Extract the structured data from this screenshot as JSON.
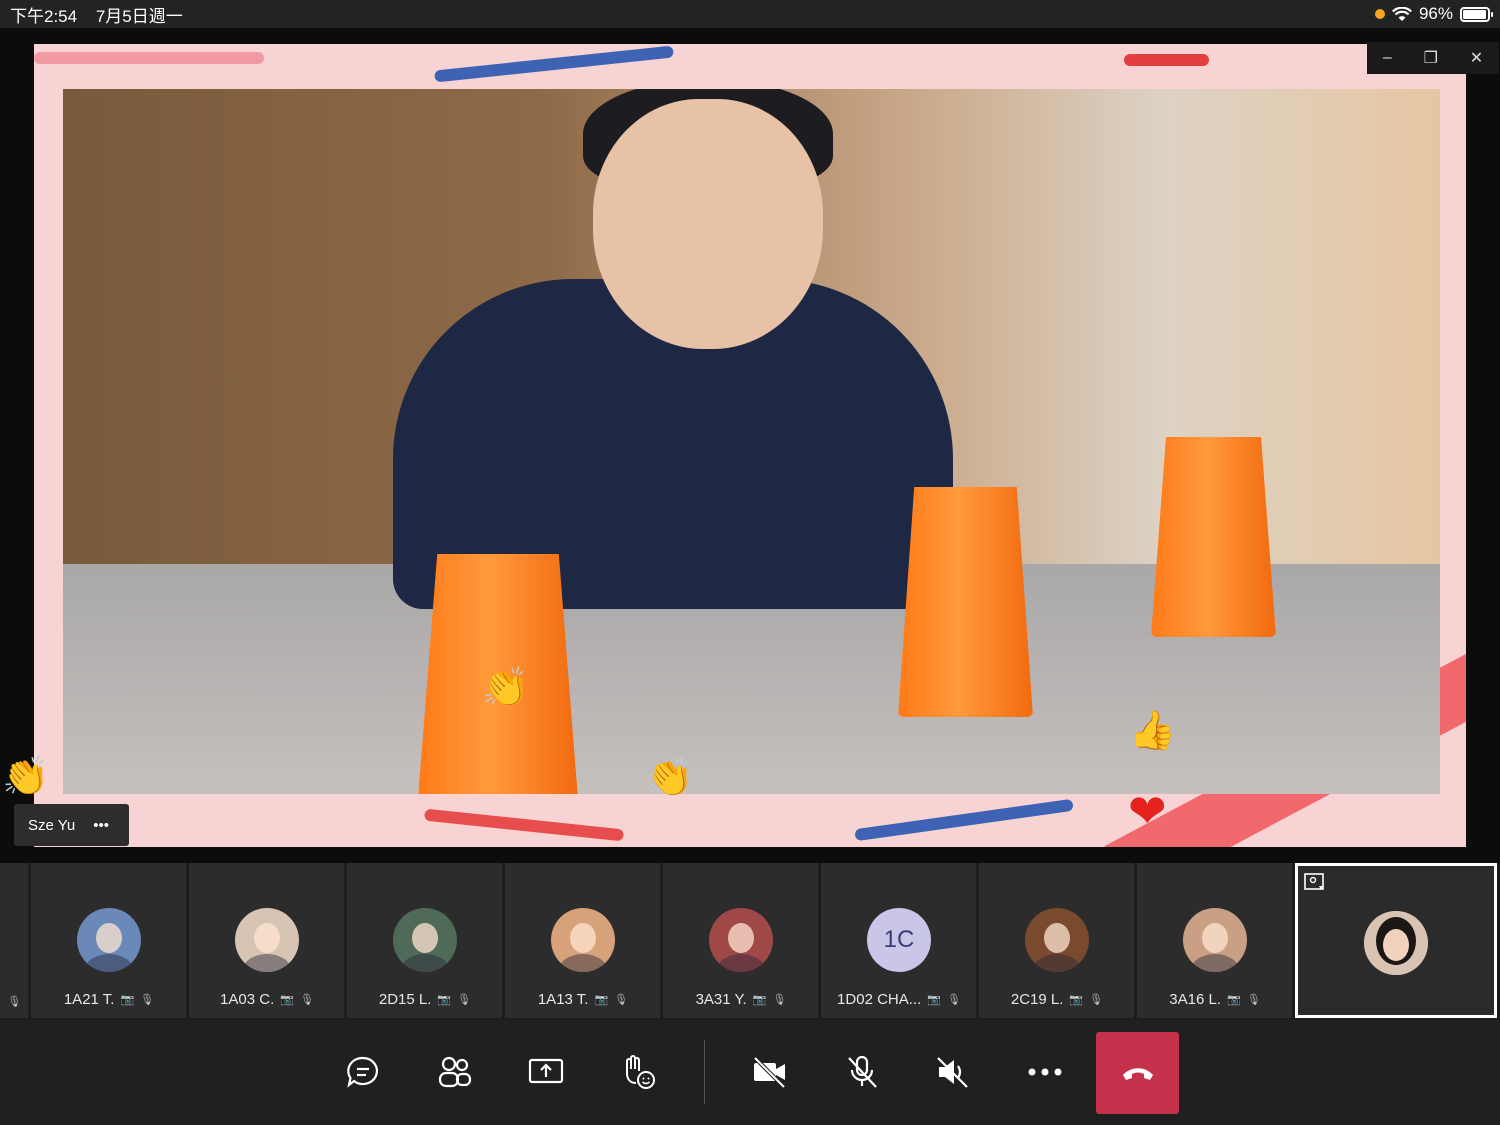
{
  "status_bar": {
    "time": "下午2:54",
    "date": "7月5日週一",
    "battery": "96%",
    "battery_level": 0.96,
    "icons": [
      "orange-dot-icon",
      "wifi-icon",
      "battery-icon"
    ]
  },
  "main_video": {
    "participant_name": "Sze Yu",
    "more_label": "•••"
  },
  "window_controls": {
    "minimize": "–",
    "restore": "❐",
    "close": "✕"
  },
  "participants": [
    {
      "name": "1A21 T.",
      "avatar": "photo",
      "color": "#6a88b8"
    },
    {
      "name": "1A03 C.",
      "avatar": "photo",
      "color": "#d8c4b2"
    },
    {
      "name": "2D15 L.",
      "avatar": "photo",
      "color": "#4f6a58"
    },
    {
      "name": "1A13 T.",
      "avatar": "photo",
      "color": "#d7a179"
    },
    {
      "name": "3A31 Y.",
      "avatar": "photo",
      "color": "#a04848"
    },
    {
      "name": "1D02 CHA...",
      "avatar": "initials",
      "initials": "1C",
      "color": "#c9c6e8"
    },
    {
      "name": "2C19 L.",
      "avatar": "photo",
      "color": "#7a4a2f"
    },
    {
      "name": "3A16 L.",
      "avatar": "photo",
      "color": "#c9a084"
    }
  ],
  "toolbar": {
    "buttons": [
      "chat-icon",
      "participants-icon",
      "share-screen-icon",
      "raise-hand-icon",
      "camera-off-icon",
      "mic-off-icon",
      "speaker-off-icon",
      "more-icon",
      "hang-up-icon"
    ]
  },
  "colors": {
    "accent_hangup": "#c4314b",
    "tile_bg": "#2c2c2c",
    "frame_pink": "#f7d3d3"
  }
}
